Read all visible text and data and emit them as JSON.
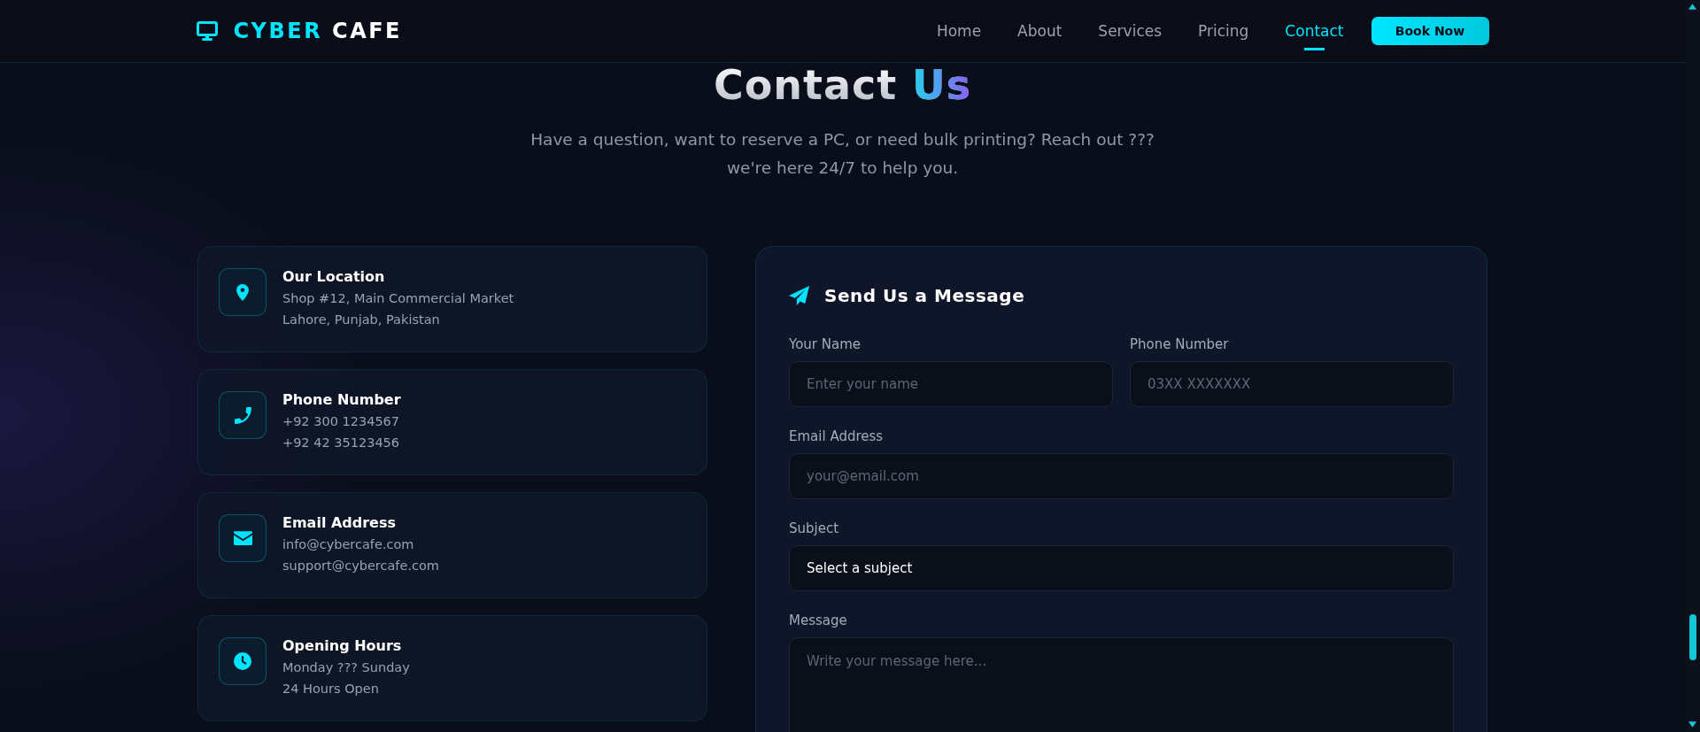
{
  "header": {
    "logo": {
      "accent": "CYBER",
      "rest": "CAFE"
    },
    "nav": [
      {
        "label": "Home",
        "selected": false
      },
      {
        "label": "About",
        "selected": false
      },
      {
        "label": "Services",
        "selected": false
      },
      {
        "label": "Pricing",
        "selected": false
      },
      {
        "label": "Contact",
        "selected": true
      }
    ],
    "cta": "Book Now"
  },
  "hero": {
    "title": "Contact",
    "title_highlight": "Us",
    "subtitle": "Have a question, want to reserve a PC, or need bulk printing? Reach out ??? we're here 24/7 to help you."
  },
  "contact_cards": [
    {
      "kind": "location",
      "title": "Our Location",
      "lines": [
        "Shop #12, Main Commercial Market",
        "Lahore, Punjab, Pakistan"
      ]
    },
    {
      "kind": "phone",
      "title": "Phone Number",
      "lines": [
        "+92 300 1234567",
        "+92 42 35123456"
      ]
    },
    {
      "kind": "email",
      "title": "Email Address",
      "lines": [
        "info@cybercafe.com",
        "support@cybercafe.com"
      ]
    },
    {
      "kind": "hours",
      "title": "Opening Hours",
      "lines": [
        "Monday ??? Sunday",
        "24 Hours Open"
      ]
    }
  ],
  "form": {
    "title": "Send Us a Message",
    "rows": [
      [
        {
          "kind": "input",
          "label": "Your Name",
          "placeholder": "Enter your name"
        },
        {
          "kind": "input",
          "label": "Phone Number",
          "placeholder": "03XX XXXXXXX"
        }
      ],
      [
        {
          "kind": "input",
          "label": "Email Address",
          "placeholder": "your@email.com"
        }
      ],
      [
        {
          "kind": "select",
          "label": "Subject",
          "value": "Select a subject"
        }
      ],
      [
        {
          "kind": "textarea",
          "label": "Message",
          "placeholder": "Write your message here..."
        }
      ]
    ]
  }
}
